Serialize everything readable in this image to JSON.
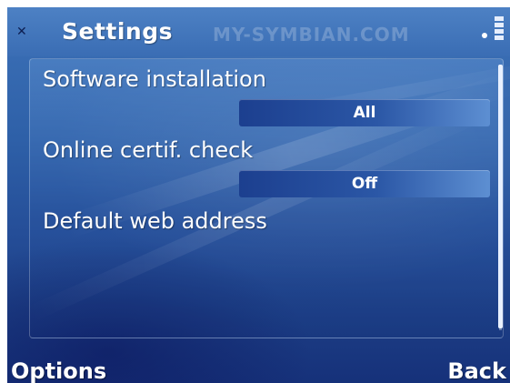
{
  "title_bar": {
    "title": "Settings",
    "watermark": "MY-SYMBIAN.COM"
  },
  "settings_list": [
    {
      "label": "Software installation",
      "value": "All"
    },
    {
      "label": "Online certif. check",
      "value": "Off"
    },
    {
      "label": "Default web address",
      "value": ""
    }
  ],
  "softkeys": {
    "left": "Options",
    "right": "Back"
  },
  "colors": {
    "background_top": "#3d72b8",
    "background_bottom": "#16317a",
    "value_box_dark": "#1c3f8f",
    "value_box_light": "#5d8fd2",
    "text": "#ffffff"
  }
}
